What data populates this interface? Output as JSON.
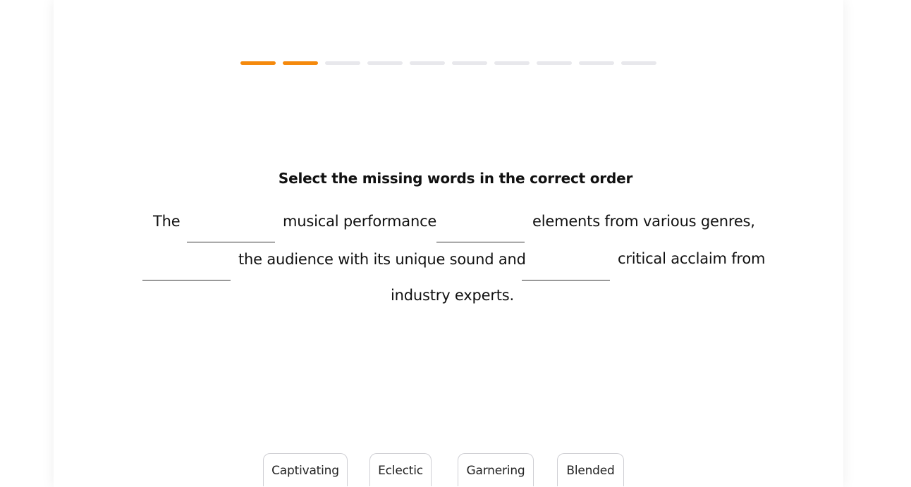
{
  "progress": {
    "total_steps": 10,
    "completed_steps": 2,
    "active_color": "#f5890c",
    "inactive_color": "#e8e8ec"
  },
  "question": {
    "instruction": "Select the missing words in the correct order",
    "sentence": {
      "t1": "The",
      "t2": "musical performance",
      "t3": "elements from various genres,",
      "t4": "the audience with its unique sound and",
      "t5": "critical acclaim from",
      "t6": "industry experts."
    }
  },
  "options": {
    "o1": "Captivating",
    "o2": "Eclectic",
    "o3": "Garnering",
    "o4": "Blended"
  }
}
